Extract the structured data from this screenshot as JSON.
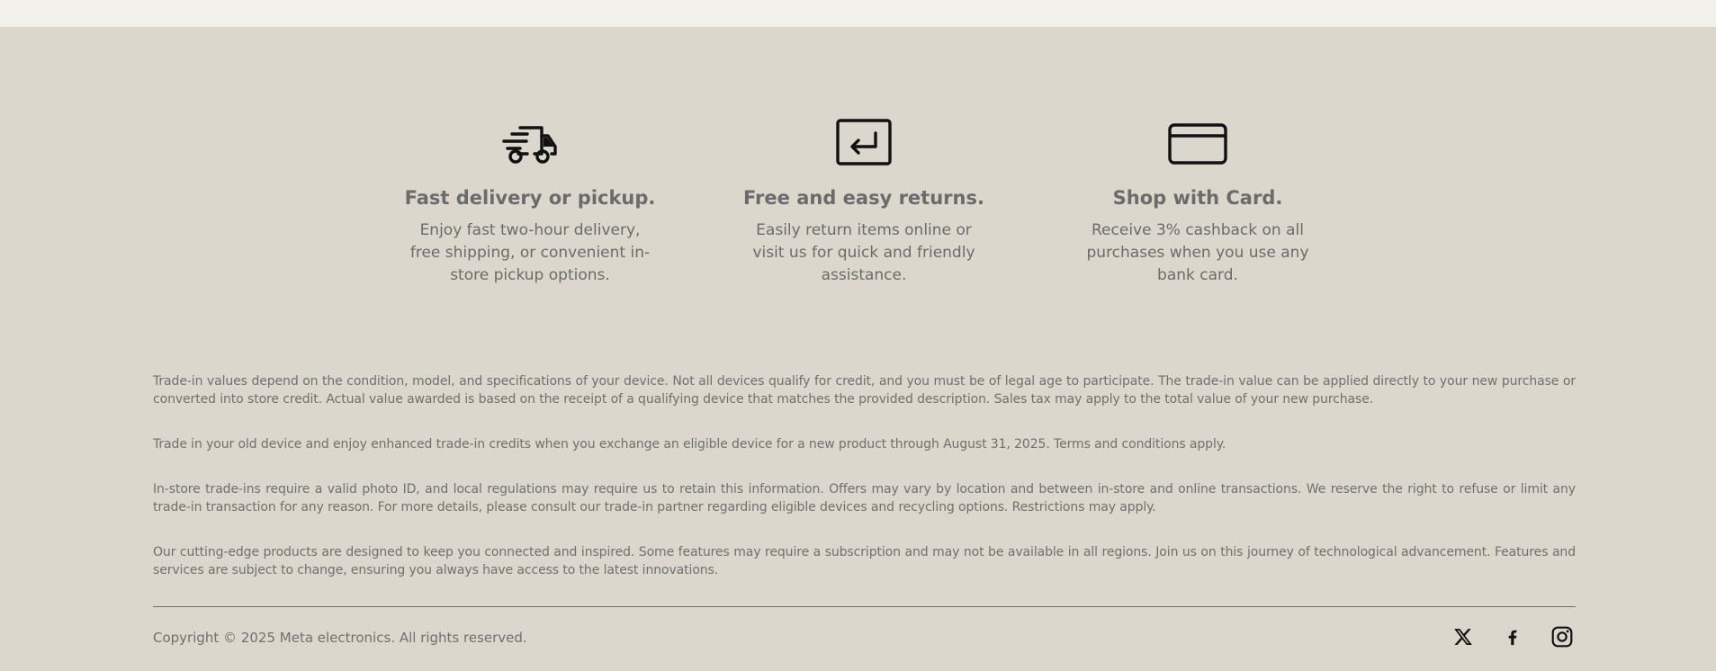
{
  "features": [
    {
      "icon": "delivery-truck-icon",
      "title": "Fast delivery or pickup.",
      "description": "Enjoy fast two-hour delivery, free shipping, or convenient in-store pickup options."
    },
    {
      "icon": "return-arrow-icon",
      "title": "Free and easy returns.",
      "description": "Easily return items online or visit us for quick and friendly assistance."
    },
    {
      "icon": "credit-card-icon",
      "title": "Shop with Card.",
      "description": "Receive 3% cashback on all purchases when you use any bank card."
    }
  ],
  "legal": [
    "Trade-in values depend on the condition, model, and specifications of your device. Not all devices qualify for credit, and you must be of legal age to participate. The trade-in value can be applied directly to your new purchase or converted into store credit. Actual value awarded is based on the receipt of a qualifying device that matches the provided description. Sales tax may apply to the total value of your new purchase.",
    "Trade in your old device and enjoy enhanced trade-in credits when you exchange an eligible device for a new product through August 31, 2025. Terms and conditions apply.",
    "In-store trade-ins require a valid photo ID, and local regulations may require us to retain this information. Offers may vary by location and between in-store and online transactions. We reserve the right to refuse or limit any trade-in transaction for any reason. For more details, please consult our trade-in partner regarding eligible devices and recycling options. Restrictions may apply.",
    "Our cutting-edge products are designed to keep you connected and inspired. Some features may require a subscription and may not be available in all regions. Join us on this journey of technological advancement. Features and services are subject to change, ensuring you always have access to the latest innovations."
  ],
  "copyright": "Copyright © 2025 Meta electronics. All rights reserved.",
  "social": [
    "x-icon",
    "facebook-icon",
    "instagram-icon"
  ],
  "colors": {
    "background": "#dbd7cc",
    "top_strip": "#f1f0eb",
    "text": "#6b6b6b",
    "icon": "#111111"
  }
}
